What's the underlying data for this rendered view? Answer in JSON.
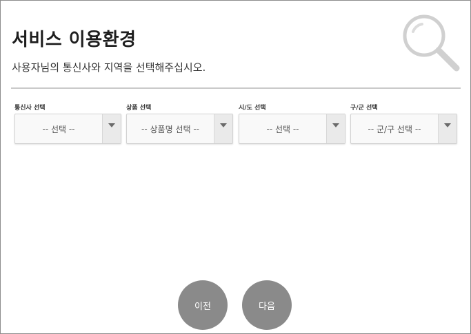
{
  "page": {
    "title": "서비스 이용환경",
    "subtitle": "사용자님의 통신사와 지역을 선택해주십시오."
  },
  "filters": [
    {
      "label": "통신사 선택",
      "value": "-- 선택 --"
    },
    {
      "label": "상품 선택",
      "value": "-- 상품명 선택 --"
    },
    {
      "label": "시/도 선택",
      "value": "-- 선택 --"
    },
    {
      "label": "구/군 선택",
      "value": "-- 군/구 선택 --"
    }
  ],
  "buttons": {
    "prev_label": "이전",
    "next_label": "다음"
  },
  "icons": {
    "decoration": "search-icon",
    "dropdown": "chevron-down-icon"
  },
  "colors": {
    "button_bg": "#8a8a8a",
    "divider": "#c9c9c9",
    "decoration": "#d0d0d0"
  }
}
